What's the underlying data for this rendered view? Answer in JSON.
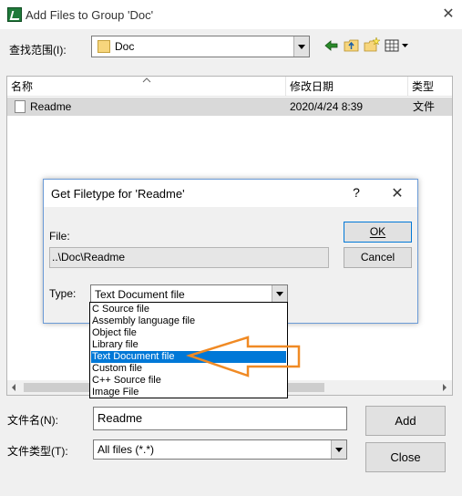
{
  "window": {
    "title": "Add Files to Group 'Doc'",
    "close_glyph": "✕"
  },
  "lookin": {
    "label": "查找范围(I):",
    "value": "Doc",
    "toolbar_icons": [
      "back-icon",
      "up-folder-icon",
      "new-folder-icon",
      "view-menu-icon"
    ]
  },
  "filelist": {
    "columns": [
      "名称",
      "修改日期",
      "类型"
    ],
    "rows": [
      {
        "name": "Readme",
        "modified": "2020/4/24 8:39",
        "type": "文件"
      }
    ]
  },
  "form": {
    "filename_label": "文件名(N):",
    "filename_value": "Readme",
    "filetype_label": "文件类型(T):",
    "filetype_value": "All files (*.*)",
    "add_label": "Add",
    "close_label": "Close"
  },
  "dialog": {
    "title": "Get Filetype for 'Readme'",
    "help_glyph": "?",
    "close_glyph": "✕",
    "file_label": "File:",
    "file_value": "..\\Doc\\Readme",
    "type_label": "Type:",
    "type_value": "Text Document file",
    "ok_label": "OK",
    "cancel_label": "Cancel"
  },
  "dropdown": {
    "options": [
      "C Source file",
      "Assembly language file",
      "Object file",
      "Library file",
      "Text Document file",
      "Custom file",
      "C++ Source file",
      "Image File"
    ],
    "selected_index": 4
  },
  "colors": {
    "selection": "#0078d7",
    "annotation_arrow": "#f08a24",
    "row_highlight": "#d9d9d9"
  }
}
